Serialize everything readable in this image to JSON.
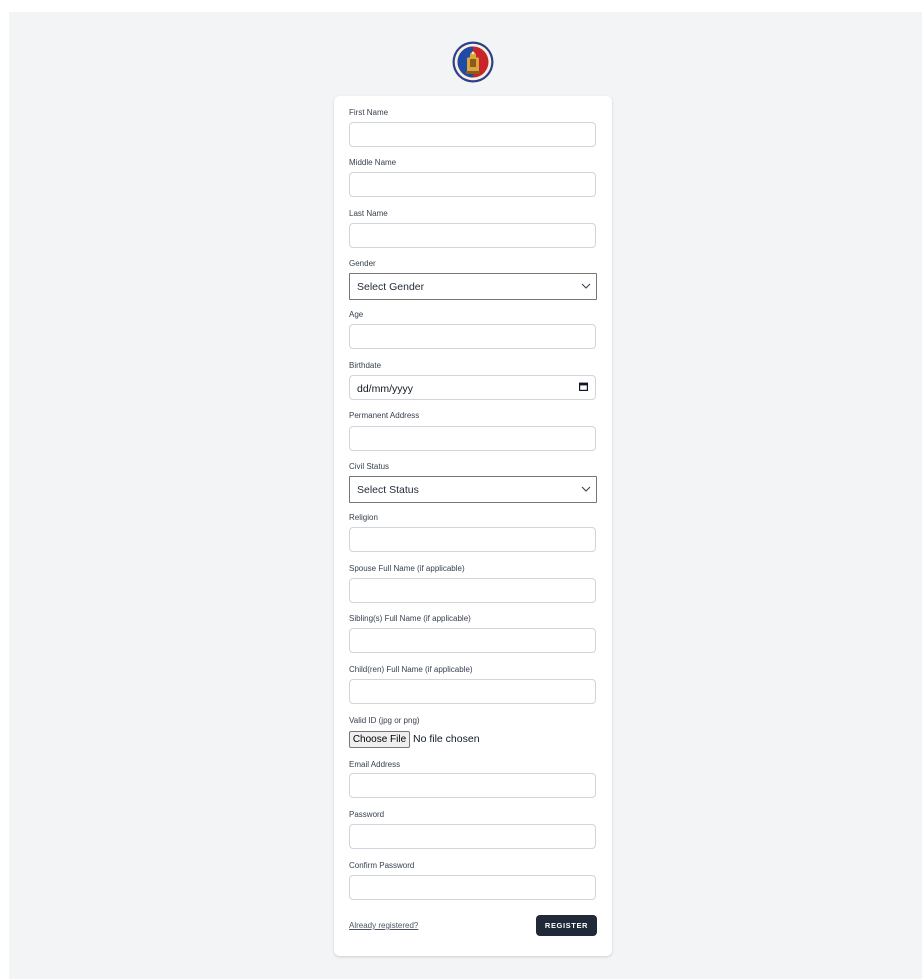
{
  "form": {
    "first_name_label": "First Name",
    "middle_name_label": "Middle Name",
    "last_name_label": "Last Name",
    "gender_label": "Gender",
    "gender_selected": "Select Gender",
    "age_label": "Age",
    "birthdate_label": "Birthdate",
    "birthdate_value": "dd/mm/yyyy",
    "permanent_address_label": "Permanent Address",
    "civil_status_label": "Civil Status",
    "civil_status_selected": "Select Status",
    "religion_label": "Religion",
    "spouse_label": "Spouse Full Name (if applicable)",
    "siblings_label": "Sibling(s) Full Name (if applicable)",
    "children_label": "Child(ren) Full Name (if applicable)",
    "valid_id_label": "Valid ID (jpg or png)",
    "file_button_label": "Choose File",
    "file_status": "No file chosen",
    "email_label": "Email Address",
    "password_label": "Password",
    "confirm_password_label": "Confirm Password",
    "already_registered": "Already registered?",
    "register_button": "REGISTER"
  },
  "icons": {
    "logo": "seal-logo",
    "gender_chevron": "chevron-down-icon",
    "civil_status_chevron": "chevron-down-icon",
    "calendar": "calendar-icon"
  },
  "colors": {
    "page_background": "#f3f4f6",
    "card_background": "#ffffff",
    "button_background": "#1f2937",
    "label_text": "#374151"
  }
}
